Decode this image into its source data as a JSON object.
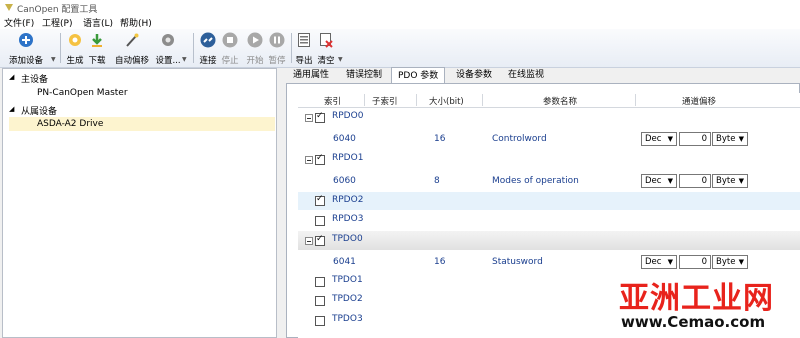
{
  "app": {
    "title": "CanOpen 配置工具"
  },
  "menu": [
    "文件(F)",
    "工程(P)",
    "语言(L)",
    "帮助(H)"
  ],
  "toolbar": {
    "add_device": "添加设备",
    "generate": "生成",
    "download": "下载",
    "auto_offset": "自动偏移",
    "settings": "设置...",
    "connect": "连接",
    "stop": "停止",
    "start": "开始",
    "pause": "暂停",
    "export": "导出",
    "clear": "清空"
  },
  "tree": {
    "master_group": "主设备",
    "master_item": "PN-CanOpen Master",
    "slave_group": "从属设备",
    "slave_item": "ASDA-A2 Drive"
  },
  "tabs": [
    "通用属性",
    "错误控制",
    "PDO 参数",
    "设备参数",
    "在线监视"
  ],
  "active_tab": 2,
  "columns": {
    "index": "索引",
    "subindex": "子索引",
    "size": "大小(bit)",
    "name": "参数名称",
    "offset": "通道偏移"
  },
  "pdo_rows": {
    "rpdo0": "RPDO0",
    "rpdo0_item": {
      "index": "6040",
      "size": "16",
      "name": "Controlword",
      "fmt": "Dec",
      "offset": "0",
      "unit": "Byte"
    },
    "rpdo1": "RPDO1",
    "rpdo1_item": {
      "index": "6060",
      "size": "8",
      "name": "Modes of operation",
      "fmt": "Dec",
      "offset": "0",
      "unit": "Byte"
    },
    "rpdo2": "RPDO2",
    "rpdo3": "RPDO3",
    "tpdo0": "TPDO0",
    "tpdo0_item": {
      "index": "6041",
      "size": "16",
      "name": "Statusword",
      "fmt": "Dec",
      "offset": "0",
      "unit": "Byte"
    },
    "tpdo1": "TPDO1",
    "tpdo2": "TPDO2",
    "tpdo3": "TPDO3"
  },
  "watermark": {
    "main": "亚洲工业网",
    "url": "www.Cemao.com"
  },
  "colors": {
    "accent": "#1b3f8f",
    "selection": "#fdf4cf",
    "watermark": "#e8231c"
  }
}
